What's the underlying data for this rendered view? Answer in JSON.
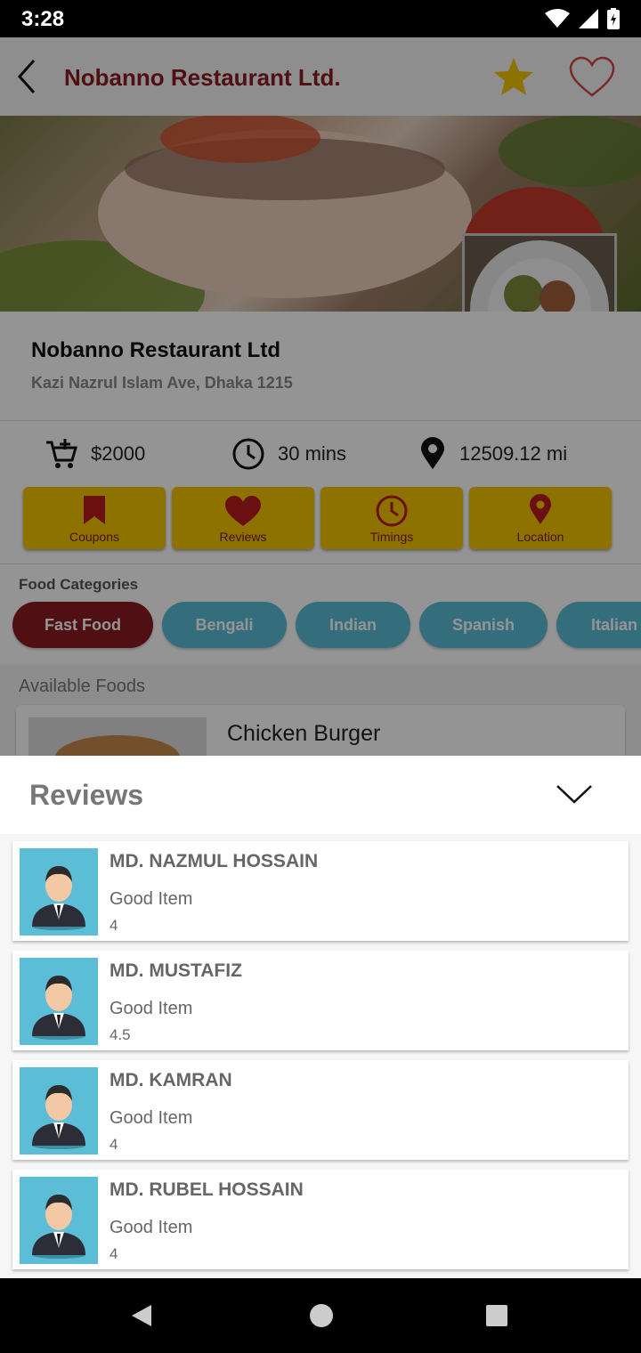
{
  "status_bar": {
    "time": "3:28"
  },
  "app_bar": {
    "title": "Nobanno Restaurant Ltd."
  },
  "restaurant": {
    "name": "Nobanno Restaurant Ltd",
    "address": "Kazi Nazrul Islam Ave, Dhaka 1215"
  },
  "stats": {
    "min_order": "$2000",
    "delivery_time": "30 mins",
    "distance": "12509.12 mi"
  },
  "actions": [
    "Coupons",
    "Reviews",
    "Timings",
    "Location"
  ],
  "categories": {
    "heading": "Food Categories",
    "items": [
      "Fast Food",
      "Bengali",
      "Indian",
      "Spanish",
      "Italian"
    ]
  },
  "available": {
    "heading": "Available Foods",
    "first_food": "Chicken Burger"
  },
  "reviews": {
    "title": "Reviews",
    "items": [
      {
        "name": "MD. NAZMUL HOSSAIN",
        "comment": "Good Item",
        "rating": "4"
      },
      {
        "name": "MD. MUSTAFIZ",
        "comment": "Good Item",
        "rating": "4.5"
      },
      {
        "name": "MD. KAMRAN",
        "comment": "Good Item",
        "rating": "4"
      },
      {
        "name": "MD. RUBEL HOSSAIN",
        "comment": "Good Item",
        "rating": "4"
      }
    ]
  },
  "colors": {
    "brand": "#8b1a22",
    "accent": "#f4c400",
    "chip_active": "#8b1a22",
    "chip_inactive": "#5bbdd6"
  },
  "icons": {
    "app_bar": [
      "back-arrow-icon",
      "star-icon",
      "heart-outline-icon"
    ],
    "stats": [
      "cart-icon",
      "clock-icon",
      "location-pin-icon"
    ],
    "actions": [
      "bookmark-icon",
      "heart-icon",
      "clock-icon",
      "location-pin-icon"
    ]
  }
}
